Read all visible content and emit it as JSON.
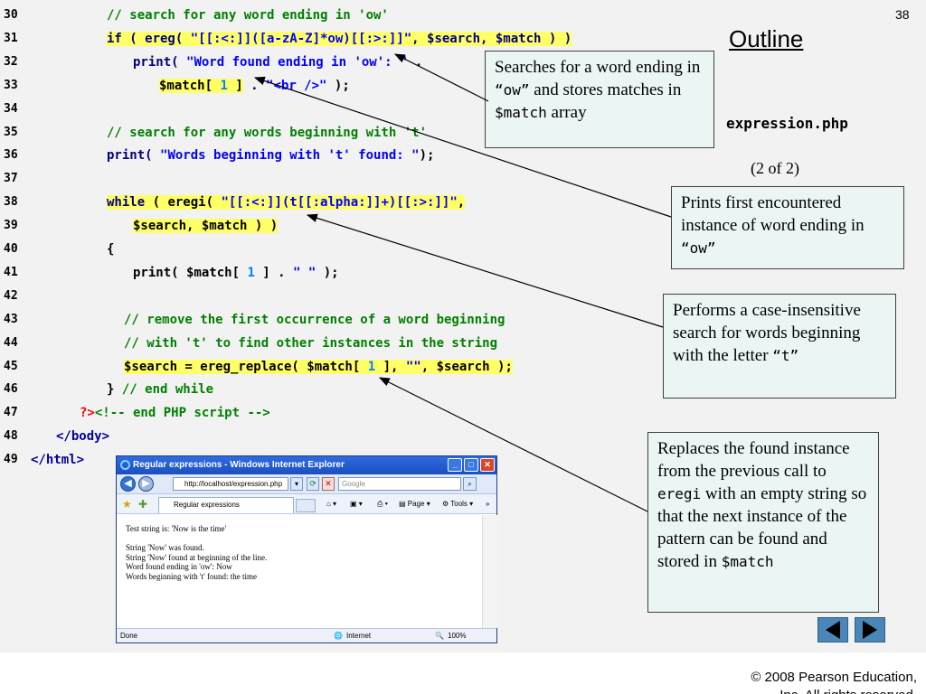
{
  "slide": {
    "page_number": "38",
    "outline_label": "Outline",
    "filename": "expression.php",
    "page_count": "(2 of 2)",
    "copyright_line1": "© 2008 Pearson Education,",
    "copyright_line2": "Inc.  All rights reserved."
  },
  "code": {
    "lines": [
      {
        "num": "30",
        "segments": [
          {
            "t": "// search for any word ending in 'ow'",
            "c": "c-cm",
            "hl": false
          }
        ]
      },
      {
        "num": "31",
        "segments": [
          {
            "t": "if ( ereg( ",
            "c": "c-kw",
            "hl": true
          },
          {
            "t": "\"[[:<:]]([a-zA-Z]*ow)[[:>:]]\"",
            "c": "c-st",
            "hl": true
          },
          {
            "t": ", $search, $match ) )",
            "c": "c-kw",
            "hl": true
          }
        ]
      },
      {
        "num": "32",
        "segments": [
          {
            "t": "print( ",
            "c": "c-kw",
            "hl": false
          },
          {
            "t": "\"Word found ending in 'ow': \"",
            "c": "c-st",
            "hl": false
          },
          {
            "t": " .",
            "c": "c-bl",
            "hl": false
          }
        ]
      },
      {
        "num": "33",
        "segments": [
          {
            "t": "$match[ ",
            "c": "c-bl",
            "hl": true
          },
          {
            "t": "1",
            "c": "c-num",
            "hl": true
          },
          {
            "t": " ]",
            "c": "c-bl",
            "hl": true
          },
          {
            "t": " . ",
            "c": "c-bl",
            "hl": false
          },
          {
            "t": "\"<br />\"",
            "c": "c-st",
            "hl": false
          },
          {
            "t": " );",
            "c": "c-bl",
            "hl": false
          }
        ]
      },
      {
        "num": "34",
        "segments": []
      },
      {
        "num": "35",
        "segments": [
          {
            "t": "// search for any words beginning with 't'",
            "c": "c-cm",
            "hl": false
          }
        ]
      },
      {
        "num": "36",
        "segments": [
          {
            "t": "print( ",
            "c": "c-kw",
            "hl": false
          },
          {
            "t": "\"Words beginning with 't' found: \"",
            "c": "c-st",
            "hl": false
          },
          {
            "t": ");",
            "c": "c-bl",
            "hl": false
          }
        ]
      },
      {
        "num": "37",
        "segments": []
      },
      {
        "num": "38",
        "segments": [
          {
            "t": "while",
            "c": "c-kw",
            "hl": true
          },
          {
            "t": " ( eregi( ",
            "c": "c-bl",
            "hl": true
          },
          {
            "t": "\"[[:<:]](t[[:alpha:]]+)[[:>:]]\"",
            "c": "c-st",
            "hl": true
          },
          {
            "t": ",",
            "c": "c-bl",
            "hl": true
          }
        ]
      },
      {
        "num": "39",
        "segments": [
          {
            "t": "$search, $match ) )",
            "c": "c-bl",
            "hl": true
          }
        ]
      },
      {
        "num": "40",
        "segments": [
          {
            "t": "{",
            "c": "c-bl",
            "hl": false
          }
        ]
      },
      {
        "num": "41",
        "segments": [
          {
            "t": "print( $match[ ",
            "c": "c-bl",
            "hl": false
          },
          {
            "t": "1",
            "c": "c-num",
            "hl": false
          },
          {
            "t": " ] . ",
            "c": "c-bl",
            "hl": false
          },
          {
            "t": "\" \"",
            "c": "c-st",
            "hl": false
          },
          {
            "t": " );",
            "c": "c-bl",
            "hl": false
          }
        ]
      },
      {
        "num": "42",
        "segments": []
      },
      {
        "num": "43",
        "segments": [
          {
            "t": "// remove the first occurrence of a word beginning",
            "c": "c-cm",
            "hl": false
          }
        ]
      },
      {
        "num": "44",
        "segments": [
          {
            "t": "// with 't' to find other instances in the string",
            "c": "c-cm",
            "hl": false
          }
        ]
      },
      {
        "num": "45",
        "segments": [
          {
            "t": "$search = ereg_replace( $match[ ",
            "c": "c-bl",
            "hl": true
          },
          {
            "t": "1",
            "c": "c-num",
            "hl": true
          },
          {
            "t": " ], ",
            "c": "c-bl",
            "hl": true
          },
          {
            "t": "\"\"",
            "c": "c-st",
            "hl": true
          },
          {
            "t": ", $search );",
            "c": "c-bl",
            "hl": true
          }
        ]
      },
      {
        "num": "46",
        "segments": [
          {
            "t": "} ",
            "c": "c-bl",
            "hl": false
          },
          {
            "t": "// end while",
            "c": "c-cm",
            "hl": false
          }
        ]
      },
      {
        "num": "47",
        "segments": [
          {
            "t": "?>",
            "c": "c-red",
            "hl": false
          },
          {
            "t": "<!-- end ",
            "c": "c-cm",
            "hl": false
          },
          {
            "t": "PHP",
            "c": "c-cm",
            "hl": false
          },
          {
            "t": " script -->",
            "c": "c-cm",
            "hl": false
          }
        ]
      },
      {
        "num": "48",
        "segments": [
          {
            "t": "</body>",
            "c": "c-php",
            "hl": false
          }
        ]
      },
      {
        "num": "49",
        "segments": [
          {
            "t": "</html>",
            "c": "c-php",
            "hl": false
          }
        ]
      }
    ]
  },
  "callouts": {
    "c1": {
      "a": "Searches for a word ending in ",
      "m": "“ow”",
      "b": " and stores matches in ",
      "m2": "$match",
      "c": " array"
    },
    "c2": {
      "a": "Prints first encountered instance of word ending in ",
      "m": "“ow”"
    },
    "c3": {
      "a": "Performs a case-insensitive search for words beginning with the letter ",
      "m": "“t”"
    },
    "c4": {
      "a": "Replaces the found instance from the previous call to ",
      "m": "eregi",
      "b": " with an empty string so that the next instance of the pattern can be found and stored in ",
      "m2": "$match"
    }
  },
  "browser": {
    "title": "Regular expressions - Windows Internet Explorer",
    "address": "http://localhost/expression.php",
    "search_placeholder": "Google",
    "tab_label": "Regular expressions",
    "page_menu": "Page",
    "tools_menu": "Tools",
    "content": [
      "Test string is: 'Now is the time'",
      "",
      "String 'Now' was found.",
      "String 'Now' found at beginning of the line.",
      "Word found ending in 'ow': Now",
      "Words beginning with 't' found: the time"
    ],
    "status_left": "Done",
    "status_zone": "Internet",
    "status_zoom": "100%"
  },
  "colors": {
    "highlight": "#ffff66",
    "comment": "#008000",
    "keyword": "#000080",
    "string": "#0000ff",
    "number": "#0080ff",
    "callout_bg": "#eaf5f4",
    "nav_button": "#4a86b8"
  },
  "icons": [
    "ie-logo-icon",
    "back-arrow-icon",
    "forward-arrow-icon",
    "refresh-icon",
    "stop-icon",
    "search-icon",
    "favorites-star-icon",
    "add-favorites-icon",
    "home-icon",
    "print-icon",
    "page-icon",
    "tools-gear-icon",
    "globe-icon",
    "zoom-icon",
    "prev-slide-icon",
    "next-slide-icon"
  ]
}
